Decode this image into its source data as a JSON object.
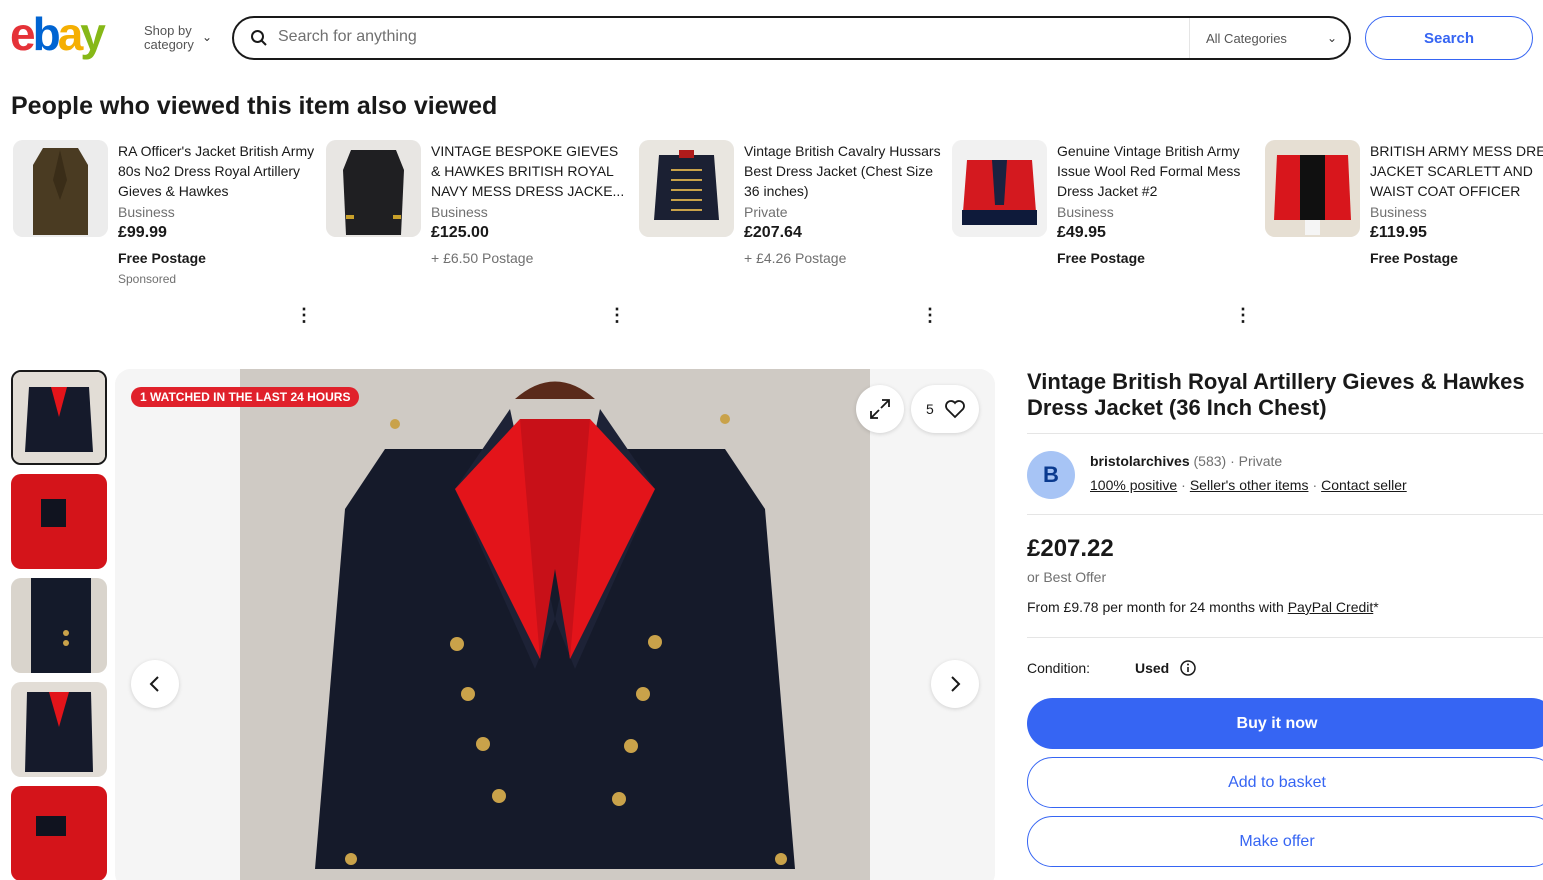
{
  "header": {
    "logo_text": "ebay",
    "shop_by_line1": "Shop by",
    "shop_by_line2": "category",
    "search_placeholder": "Search for anything",
    "category_select": "All Categories",
    "search_button": "Search"
  },
  "also_viewed": {
    "title": "People who viewed this item also viewed",
    "items": [
      {
        "title": "RA Officer's Jacket British Army 80s No2 Dress Royal Artillery Gieves & Hawkes",
        "seller_type": "Business",
        "price": "£99.99",
        "postage": "Free Postage",
        "sponsored": "Sponsored"
      },
      {
        "title": "VINTAGE BESPOKE GIEVES & HAWKES BRITISH ROYAL NAVY MESS DRESS JACKE...",
        "seller_type": "Business",
        "price": "£125.00",
        "postage": "+ £6.50 Postage"
      },
      {
        "title": "Vintage British Cavalry Hussars Best Dress Jacket (Chest Size 36 inches)",
        "seller_type": "Private",
        "price": "£207.64",
        "postage": "+ £4.26 Postage"
      },
      {
        "title": "Genuine Vintage British Army Issue Wool Red Formal Mess Dress Jacket #2",
        "seller_type": "Business",
        "price": "£49.95",
        "postage": "Free Postage"
      },
      {
        "title": "BRITISH ARMY MESS DRESS JACKET SCARLETT AND WAIST COAT OFFICER",
        "seller_type": "Business",
        "price": "£119.95",
        "postage": "Free Postage"
      }
    ]
  },
  "gallery": {
    "badge": "1 WATCHED IN THE LAST 24 HOURS",
    "watch_count": "5"
  },
  "item": {
    "title": "Vintage British Royal Artillery Gieves & Hawkes Dress Jacket (36 Inch Chest)",
    "seller_initial": "B",
    "seller_name": "bristolarchives",
    "seller_feedback": "(583)",
    "seller_dot": "·",
    "seller_type": "Private",
    "positive": "100% positive",
    "other_items": "Seller's other items",
    "contact": "Contact seller",
    "link_sep": "·",
    "price": "£207.22",
    "best_offer": "or Best Offer",
    "finance_prefix": "From £9.78 per month for 24 months with",
    "finance_link": "PayPal Credit",
    "finance_suffix": "*",
    "condition_label": "Condition:",
    "condition_value": "Used",
    "buy_now": "Buy it now",
    "add_basket": "Add to basket",
    "make_offer": "Make offer"
  },
  "colors": {
    "accent": "#3665f3",
    "badge_red": "#e0212b",
    "logo_e": "#e53238",
    "logo_b": "#0064d2",
    "logo_a": "#f5af02",
    "logo_y": "#86b817"
  }
}
